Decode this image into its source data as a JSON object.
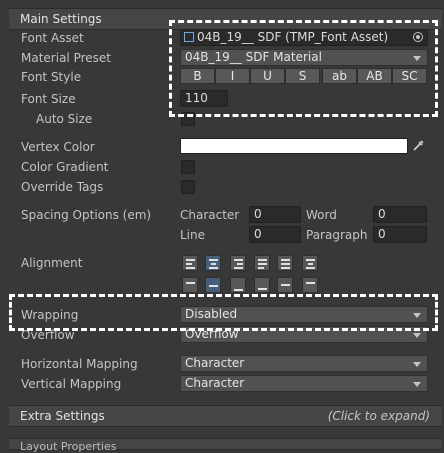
{
  "main_section": {
    "title": "Main Settings"
  },
  "labels": {
    "font_asset": "Font Asset",
    "material_preset": "Material Preset",
    "font_style": "Font Style",
    "font_size": "Font Size",
    "auto_size": "Auto Size",
    "vertex_color": "Vertex Color",
    "color_gradient": "Color Gradient",
    "override_tags": "Override Tags",
    "spacing_options": "Spacing Options (em)",
    "alignment": "Alignment",
    "wrapping": "Wrapping",
    "overflow": "Overflow",
    "horizontal_mapping": "Horizontal Mapping",
    "vertical_mapping": "Vertical Mapping"
  },
  "font_asset": {
    "value": "04B_19__ SDF (TMP_Font Asset)",
    "icon": "font-asset-icon"
  },
  "material_preset": {
    "value": "04B_19__ SDF Material"
  },
  "font_style": {
    "buttons": [
      "B",
      "I",
      "U",
      "S",
      "ab",
      "AB",
      "SC"
    ]
  },
  "font_size": {
    "value": "110"
  },
  "vertex_color": {
    "value": "#ffffff",
    "picker_icon": "eyedropper-icon"
  },
  "spacing": {
    "character_label": "Character",
    "character_value": "0",
    "word_label": "Word",
    "word_value": "0",
    "line_label": "Line",
    "line_value": "0",
    "paragraph_label": "Paragraph",
    "paragraph_value": "0"
  },
  "alignment": {
    "horizontal": [
      "align-left-icon",
      "align-center-icon",
      "align-right-icon",
      "align-justified-icon",
      "align-flush-icon",
      "align-geometry-center-icon"
    ],
    "horizontal_selected": 1,
    "vertical": [
      "align-top-icon",
      "align-middle-icon",
      "align-bottom-icon",
      "align-baseline-icon",
      "align-midline-icon",
      "align-capline-icon"
    ],
    "vertical_selected": 1
  },
  "wrapping": {
    "value": "Disabled"
  },
  "overflow": {
    "value": "Overflow"
  },
  "horizontal_mapping": {
    "value": "Character"
  },
  "vertical_mapping": {
    "value": "Character"
  },
  "extra_section": {
    "title": "Extra Settings",
    "hint": "(Click to expand)"
  },
  "bottom_section": {
    "title": "Layout Properties"
  },
  "colors": {
    "highlight": "#46607c",
    "background": "#383838"
  }
}
